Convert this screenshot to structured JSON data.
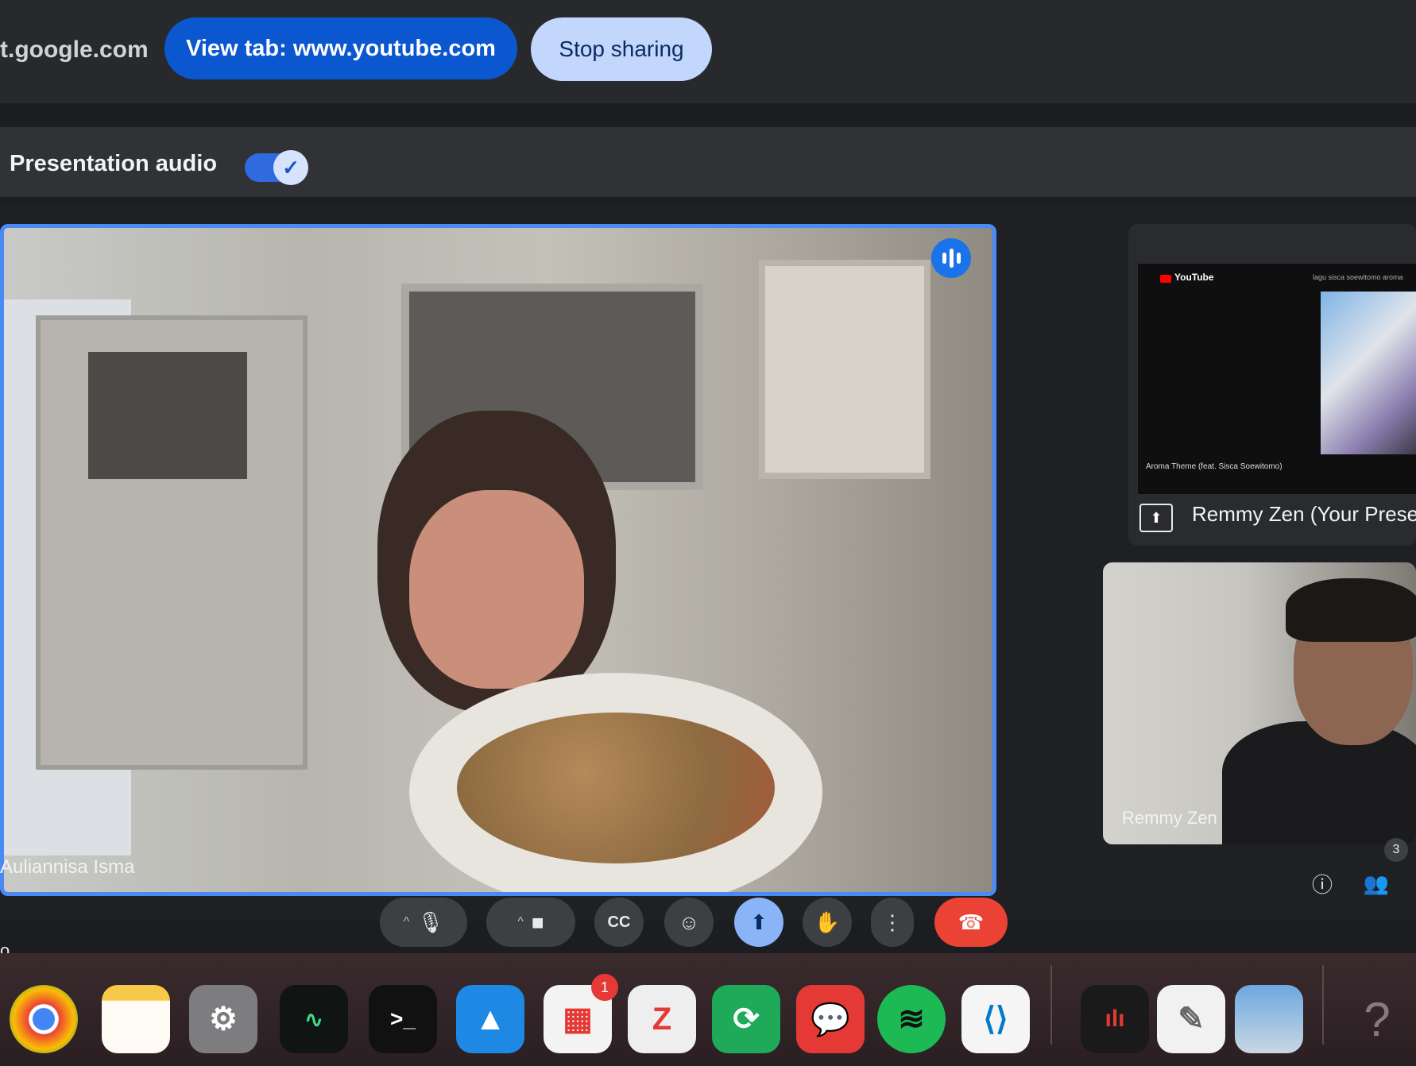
{
  "sharebar": {
    "domain_partial": "t.google.com",
    "view_tab_label": "View tab: www.youtube.com",
    "stop_sharing_label": "Stop sharing"
  },
  "audio": {
    "label": "Presentation audio",
    "enabled": true
  },
  "tiles": {
    "main_participant": "Auliannisa Isma",
    "presentation_name": "Remmy Zen (Your Present",
    "presentation_content": {
      "site": "YouTube",
      "top_right_text": "lagu sisca soewitomo aroma",
      "video_title": "Aroma Theme (feat. Sisca Soewitomo)"
    },
    "second_participant": "Remmy Zen"
  },
  "side": {
    "participants_count": "3",
    "left_text": "o"
  },
  "controls": [
    {
      "name": "mic",
      "icon": "microphone-icon"
    },
    {
      "name": "camera",
      "icon": "camera-icon"
    },
    {
      "name": "captions",
      "label": "CC"
    },
    {
      "name": "reactions",
      "icon": "emoji-icon"
    },
    {
      "name": "present",
      "icon": "present-icon"
    },
    {
      "name": "raise-hand",
      "icon": "hand-icon"
    },
    {
      "name": "more",
      "icon": "more-vert-icon"
    },
    {
      "name": "leave",
      "icon": "end-call-icon"
    }
  ],
  "dock": {
    "notification_count": "1",
    "z_app_letter": "Z",
    "help_glyph": "?"
  },
  "colors": {
    "accent": "#1a73e8",
    "end_call": "#ea4335",
    "view_tab_button": "#0b57d0",
    "stop_sharing_button": "#c2d7fb"
  }
}
